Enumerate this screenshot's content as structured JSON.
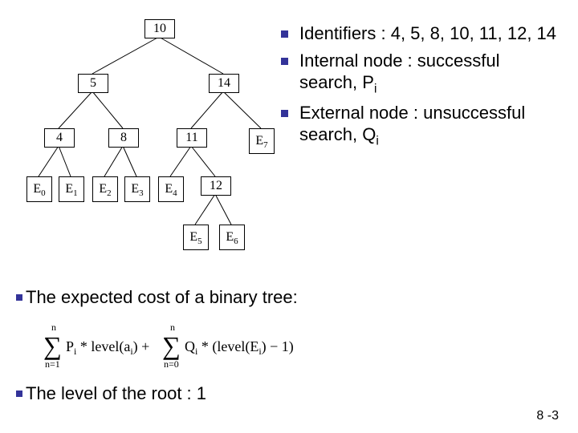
{
  "tree": {
    "internal": {
      "n10": "10",
      "n5": "5",
      "n14": "14",
      "n4": "4",
      "n8": "8",
      "n11": "11",
      "n12": "12"
    },
    "external": {
      "e0": "E",
      "e0s": "0",
      "e1": "E",
      "e1s": "1",
      "e2": "E",
      "e2s": "2",
      "e3": "E",
      "e3s": "3",
      "e4": "E",
      "e4s": "4",
      "e5": "E",
      "e5s": "5",
      "e6": "E",
      "e6s": "6",
      "e7": "E",
      "e7s": "7"
    }
  },
  "right_bullets": {
    "b1": "Identifiers : 4, 5, 8, 10, 11, 12, 14",
    "b2a": "Internal node : successful search, P",
    "b2sub": "i",
    "b3a": "External node : unsuccessful search, Q",
    "b3sub": "i"
  },
  "lower": {
    "l1": "The expected cost of a binary tree:",
    "l2": "The level of the root : 1"
  },
  "formula": {
    "sum1_top": "n",
    "sum1_bot": "n=1",
    "term1a": "P",
    "term1sub": "i",
    "term1b": " * level(a",
    "term1bsub": "i",
    "term1c": ") + ",
    "sum2_top": "n",
    "sum2_bot": "n=0",
    "term2a": "Q",
    "term2sub": "i",
    "term2b": " * (level(E",
    "term2bsub": "i",
    "term2c": ") − 1)"
  },
  "page_number": "8 -3",
  "chart_data": {
    "type": "tree",
    "title": "Binary search tree example",
    "internal_nodes": [
      10,
      5,
      14,
      4,
      8,
      11,
      12
    ],
    "external_nodes": [
      "E0",
      "E1",
      "E2",
      "E3",
      "E4",
      "E5",
      "E6",
      "E7"
    ],
    "edges": [
      [
        "10",
        "5"
      ],
      [
        "10",
        "14"
      ],
      [
        "5",
        "4"
      ],
      [
        "5",
        "8"
      ],
      [
        "14",
        "11"
      ],
      [
        "14",
        "E7"
      ],
      [
        "4",
        "E0"
      ],
      [
        "4",
        "E1"
      ],
      [
        "8",
        "E2"
      ],
      [
        "8",
        "E3"
      ],
      [
        "11",
        "E4"
      ],
      [
        "11",
        "12"
      ],
      [
        "12",
        "E5"
      ],
      [
        "12",
        "E6"
      ]
    ]
  }
}
